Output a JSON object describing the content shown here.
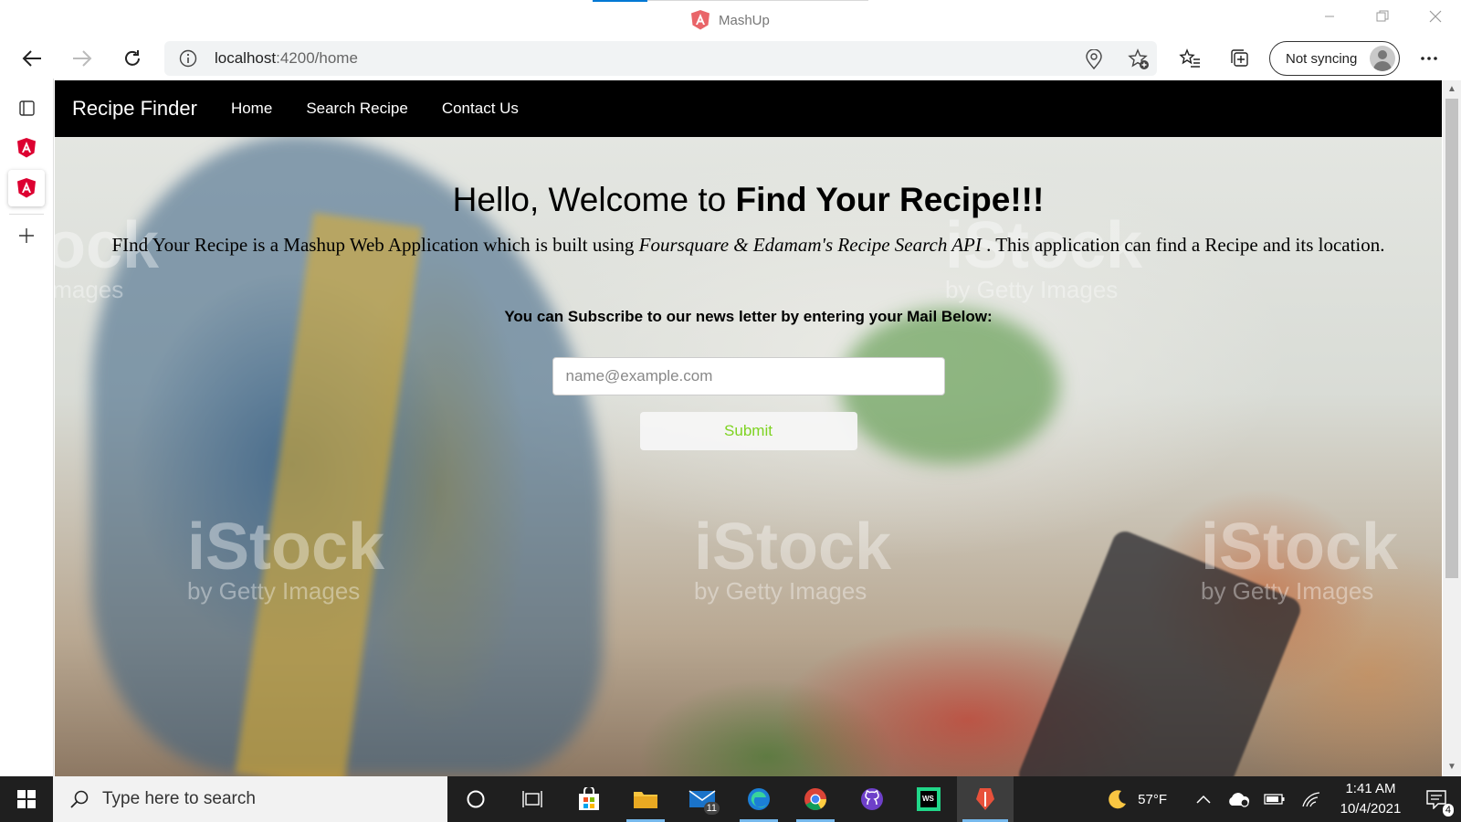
{
  "browser": {
    "window_title": "MashUp",
    "url_host": "localhost",
    "url_path": ":4200/home",
    "sync_label": "Not syncing"
  },
  "navbar": {
    "brand": "Recipe Finder",
    "links": [
      "Home",
      "Search Recipe",
      "Contact Us"
    ]
  },
  "hero": {
    "title_prefix": "Hello, Welcome to ",
    "title_bold": "Find Your Recipe!!!",
    "desc_before": "FInd Your Recipe is a Mashup Web Application which is built using ",
    "desc_italic": "Foursquare & Edamam's Recipe Search API",
    "desc_after": " . This application can find a Recipe and its location.",
    "subscribe_label": "You can Subscribe to our news letter by entering your Mail Below:",
    "email_placeholder": "name@example.com",
    "submit_label": "Submit"
  },
  "watermarks": {
    "brand": "iStock",
    "line": "by Getty Images",
    "partial_brand": "ock",
    "partial_line": "Images"
  },
  "taskbar": {
    "search_placeholder": "Type here to search",
    "mail_badge": "11",
    "weather_temp": "57°F",
    "time": "1:41 AM",
    "date": "10/4/2021",
    "notification_count": "4"
  },
  "colors": {
    "navbar_bg": "#000000",
    "submit_text": "#7ed321",
    "angular_red": "#dd0031",
    "edge_accent": "#0078d4"
  }
}
